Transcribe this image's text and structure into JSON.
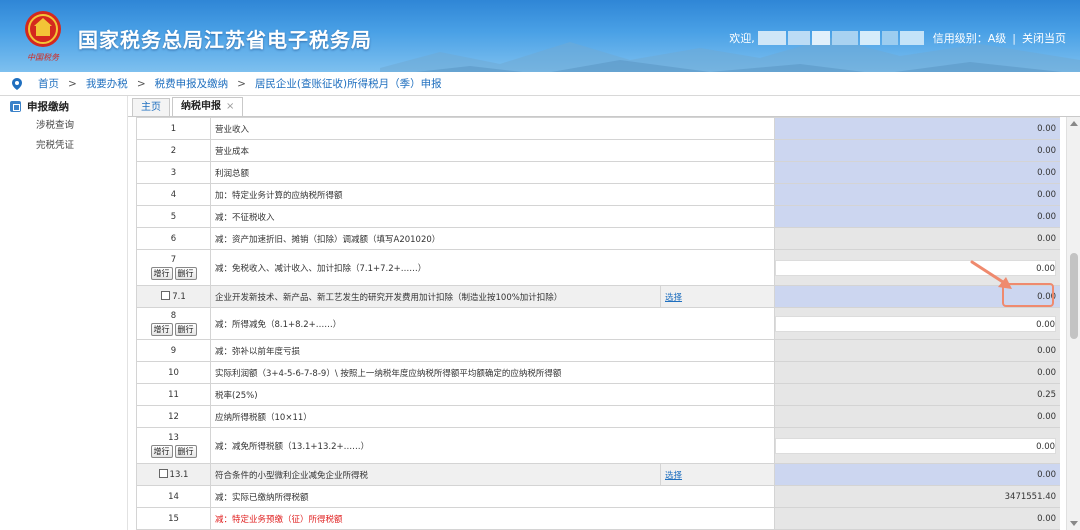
{
  "header": {
    "logo_text": "中国税务",
    "site_title": "国家税务总局江苏省电子税务局",
    "welcome": "欢迎,",
    "credit_rating": "信用级别：A级",
    "close_page": "关闭当页"
  },
  "breadcrumb": [
    "首页",
    "我要办税",
    "税费申报及缴纳",
    "居民企业(查账征收)所得税月（季）申报"
  ],
  "sidebar": {
    "section": "申报缴纳",
    "items": [
      "涉税查询",
      "完税凭证"
    ]
  },
  "tabs": [
    {
      "label": "主页",
      "active": false
    },
    {
      "label": "纳税申报",
      "active": true,
      "close": "×"
    }
  ],
  "buttons": {
    "add_row": "增行",
    "delete_row": "删行",
    "select": "选择"
  },
  "rows": [
    {
      "no": "1",
      "desc": "营业收入",
      "value": "0.00",
      "style": "blue"
    },
    {
      "no": "2",
      "desc": "营业成本",
      "value": "0.00",
      "style": "blue"
    },
    {
      "no": "3",
      "desc": "利润总额",
      "value": "0.00",
      "style": "blue"
    },
    {
      "no": "4",
      "desc": "加：特定业务计算的应纳税所得额",
      "value": "0.00",
      "style": "blue"
    },
    {
      "no": "5",
      "desc": "减：不征税收入",
      "value": "0.00",
      "style": "blue"
    },
    {
      "no": "6",
      "desc": "减：资产加速折旧、摊销（扣除）调减额（填写A201020）",
      "value": "0.00",
      "style": "gray"
    },
    {
      "no": "7",
      "desc": "减：免税收入、减计收入、加计扣除（7.1+7.2+……）",
      "value": "0.00",
      "style": "input"
    },
    {
      "no": "7.1",
      "desc": "企业开发新技术、新产品、新工艺发生的研究开发费用加计扣除（制造业按100%加计扣除）",
      "value": "0.00",
      "style": "sub"
    },
    {
      "no": "8",
      "desc": "减：所得减免（8.1+8.2+……）",
      "value": "0.00",
      "style": "input"
    },
    {
      "no": "9",
      "desc": "减：弥补以前年度亏损",
      "value": "0.00",
      "style": "gray"
    },
    {
      "no": "10",
      "desc": "实际利润额（3+4-5-6-7-8-9）\\ 按照上一纳税年度应纳税所得额平均额确定的应纳税所得额",
      "value": "0.00",
      "style": "gray"
    },
    {
      "no": "11",
      "desc": "税率(25%)",
      "value": "0.25",
      "style": "gray"
    },
    {
      "no": "12",
      "desc": "应纳所得税额（10×11）",
      "value": "0.00",
      "style": "gray"
    },
    {
      "no": "13",
      "desc": "减：减免所得税额（13.1+13.2+……）",
      "value": "0.00",
      "style": "input"
    },
    {
      "no": "13.1",
      "desc": "符合条件的小型微利企业减免企业所得税",
      "value": "0.00",
      "style": "sub"
    },
    {
      "no": "14",
      "desc": "减：实际已缴纳所得税额",
      "value": "3471551.40",
      "style": "gray"
    },
    {
      "no": "15",
      "desc": "减：特定业务预缴（征）所得税额",
      "value": "0.00",
      "style": "gray-red"
    }
  ]
}
